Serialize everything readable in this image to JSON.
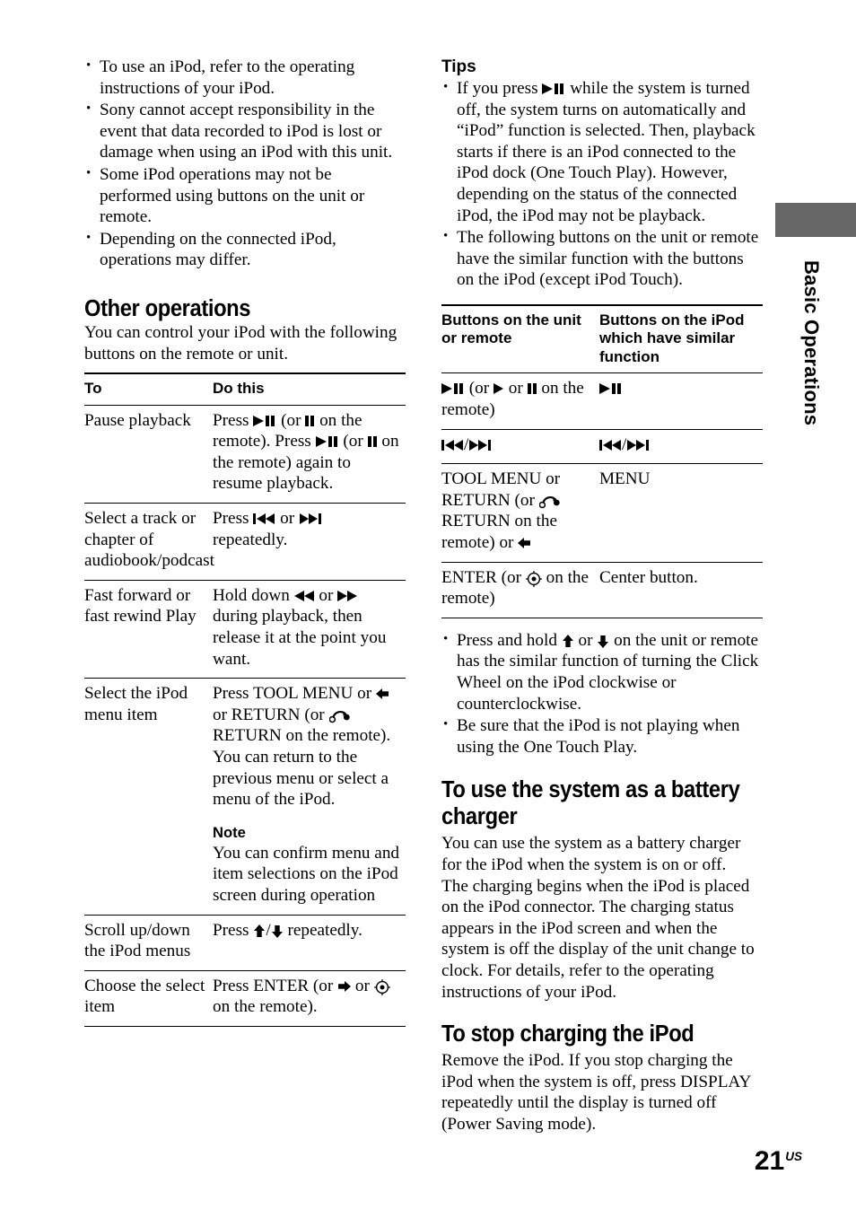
{
  "page": {
    "number": "21",
    "number_suffix": "US",
    "thumb_tab_label": "Basic Operations",
    "thumb_tab_color": "#666666"
  },
  "left_column": {
    "intro_bullets": [
      "To use an iPod, refer to the operating instructions of your iPod.",
      "Sony cannot accept responsibility in the event that data recorded to iPod is lost or damage when using an iPod with this unit.",
      "Some iPod operations may not be performed using buttons on the unit or remote.",
      "Depending on the connected iPod, operations may differ."
    ],
    "section_heading": "Other operations",
    "section_intro": "You can control your iPod with the following buttons on the remote or unit.",
    "table": {
      "headers": [
        "To",
        "Do this"
      ],
      "rows": [
        {
          "to": "Pause playback",
          "do_parts": [
            {
              "t": "text",
              "v": "Press "
            },
            {
              "t": "icon",
              "v": "play-pause-icon"
            },
            {
              "t": "text",
              "v": " (or "
            },
            {
              "t": "icon",
              "v": "pause-icon"
            },
            {
              "t": "text",
              "v": " on the remote). Press "
            },
            {
              "t": "icon",
              "v": "play-pause-icon"
            },
            {
              "t": "text",
              "v": " (or "
            },
            {
              "t": "icon",
              "v": "pause-icon"
            },
            {
              "t": "text",
              "v": " on the remote) again to resume playback."
            }
          ]
        },
        {
          "to": "Select a track or chapter of audiobook/podcast",
          "do_parts": [
            {
              "t": "text",
              "v": "Press "
            },
            {
              "t": "icon",
              "v": "skip-back-icon"
            },
            {
              "t": "text",
              "v": " or "
            },
            {
              "t": "icon",
              "v": "skip-forward-icon"
            },
            {
              "t": "text",
              "v": " repeatedly."
            }
          ]
        },
        {
          "to": "Fast forward or fast rewind Play",
          "do_parts": [
            {
              "t": "text",
              "v": "Hold down "
            },
            {
              "t": "icon",
              "v": "rewind-icon"
            },
            {
              "t": "text",
              "v": " or "
            },
            {
              "t": "icon",
              "v": "fast-forward-icon"
            },
            {
              "t": "text",
              "v": " during playback, then release it at the point you want."
            }
          ]
        },
        {
          "to": "Select the iPod menu item",
          "do_parts": [
            {
              "t": "text",
              "v": "Press TOOL MENU or "
            },
            {
              "t": "icon",
              "v": "arrow-left-icon"
            },
            {
              "t": "text",
              "v": " or RETURN (or "
            },
            {
              "t": "icon",
              "v": "return-icon"
            },
            {
              "t": "text",
              "v": " RETURN on the remote). You can return to the previous menu or select a menu of the iPod."
            }
          ],
          "note_heading": "Note",
          "note_text": "You can confirm menu and item selections on the iPod screen during operation"
        },
        {
          "to": "Scroll up/down the iPod menus",
          "do_parts": [
            {
              "t": "text",
              "v": "Press "
            },
            {
              "t": "icon",
              "v": "arrow-up-icon"
            },
            {
              "t": "text",
              "v": "/"
            },
            {
              "t": "icon",
              "v": "arrow-down-icon"
            },
            {
              "t": "text",
              "v": " repeatedly."
            }
          ]
        },
        {
          "to": "Choose the select item",
          "do_parts": [
            {
              "t": "text",
              "v": "Press ENTER (or "
            },
            {
              "t": "icon",
              "v": "arrow-right-icon"
            },
            {
              "t": "text",
              "v": " or "
            },
            {
              "t": "icon",
              "v": "enter-icon"
            },
            {
              "t": "text",
              "v": " on the remote)."
            }
          ]
        }
      ]
    }
  },
  "right_column": {
    "tips_heading": "Tips",
    "tips_bullets": [
      {
        "parts": [
          {
            "t": "text",
            "v": "If you press "
          },
          {
            "t": "icon",
            "v": "play-pause-icon"
          },
          {
            "t": "text",
            "v": " while the system is turned off, the system turns on automatically and “iPod” function is selected. Then, playback starts if there is an iPod connected to the iPod dock (One Touch Play). However, depending on the status of the connected iPod, the iPod may not be playback."
          }
        ]
      },
      {
        "parts": [
          {
            "t": "text",
            "v": "The following buttons on the unit or remote have the similar function with the buttons on the iPod (except iPod Touch)."
          }
        ]
      }
    ],
    "table": {
      "headers": [
        "Buttons on the unit or remote",
        "Buttons on the iPod which have similar function"
      ],
      "rows": [
        {
          "unit_parts": [
            {
              "t": "icon",
              "v": "play-pause-icon"
            },
            {
              "t": "text",
              "v": " (or "
            },
            {
              "t": "icon",
              "v": "play-icon"
            },
            {
              "t": "text",
              "v": " or "
            },
            {
              "t": "icon",
              "v": "pause-icon"
            },
            {
              "t": "text",
              "v": " on the remote)"
            }
          ],
          "ipod_parts": [
            {
              "t": "icon",
              "v": "play-pause-icon"
            }
          ]
        },
        {
          "unit_parts": [
            {
              "t": "icon",
              "v": "skip-back-icon"
            },
            {
              "t": "text",
              "v": "/"
            },
            {
              "t": "icon",
              "v": "skip-forward-icon"
            }
          ],
          "ipod_parts": [
            {
              "t": "icon",
              "v": "skip-back-icon"
            },
            {
              "t": "text",
              "v": "/"
            },
            {
              "t": "icon",
              "v": "skip-forward-icon"
            }
          ]
        },
        {
          "unit_parts": [
            {
              "t": "text",
              "v": "TOOL MENU or RETURN (or "
            },
            {
              "t": "icon",
              "v": "return-icon"
            },
            {
              "t": "text",
              "v": " RETURN on the remote) or "
            },
            {
              "t": "icon",
              "v": "arrow-left-icon"
            }
          ],
          "ipod_parts": [
            {
              "t": "text",
              "v": "MENU"
            }
          ]
        },
        {
          "unit_parts": [
            {
              "t": "text",
              "v": "ENTER (or "
            },
            {
              "t": "icon",
              "v": "enter-icon"
            },
            {
              "t": "text",
              "v": " on the remote)"
            }
          ],
          "ipod_parts": [
            {
              "t": "text",
              "v": "Center button."
            }
          ]
        }
      ]
    },
    "after_table_bullets": [
      {
        "parts": [
          {
            "t": "text",
            "v": "Press and hold "
          },
          {
            "t": "icon",
            "v": "arrow-up-icon"
          },
          {
            "t": "text",
            "v": " or "
          },
          {
            "t": "icon",
            "v": "arrow-down-icon"
          },
          {
            "t": "text",
            "v": " on the unit or remote has the similar function of turning the Click Wheel on the iPod clockwise or counterclockwise."
          }
        ]
      },
      {
        "parts": [
          {
            "t": "text",
            "v": "Be sure that the iPod is not playing when using the One Touch Play."
          }
        ]
      }
    ],
    "charger_heading": "To use the system as a battery charger",
    "charger_paragraphs": [
      "You can use the system as a battery charger for the iPod when the system is on or off.",
      "The charging begins when the iPod is placed on the iPod connector. The charging status appears in the iPod screen and when the system is off the display of the unit change to clock. For details, refer to the operating instructions of your iPod."
    ],
    "stop_charging_heading": "To stop charging the iPod",
    "stop_charging_paragraph": "Remove the iPod. If you stop charging the iPod when the system is off, press DISPLAY repeatedly until the display is turned off (Power Saving mode)."
  }
}
